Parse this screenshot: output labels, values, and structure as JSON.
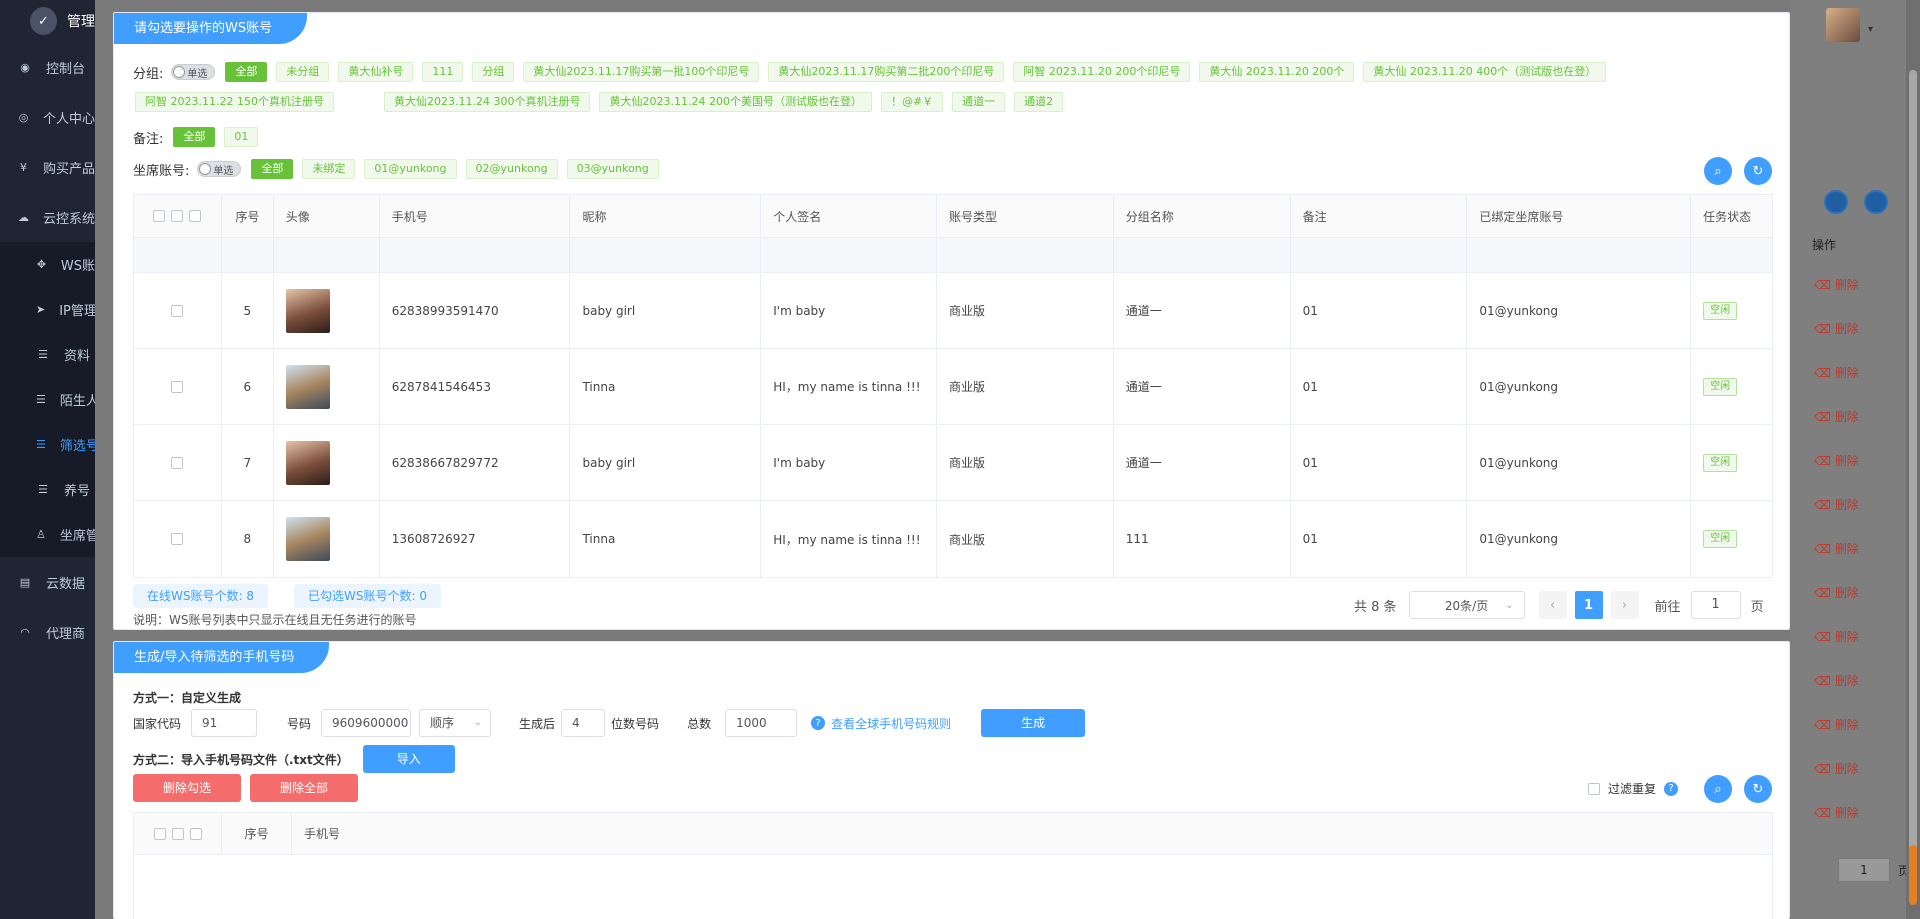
{
  "sidebar": {
    "brand": "管理",
    "items": [
      {
        "label": "控制台",
        "icon": "dashboard-icon",
        "glyph": "◉"
      },
      {
        "label": "个人中心",
        "icon": "user-icon",
        "glyph": "◎"
      },
      {
        "label": "购买产品",
        "icon": "yen-icon",
        "glyph": "¥"
      },
      {
        "label": "云控系统",
        "icon": "cloud-icon",
        "glyph": "☁"
      }
    ],
    "subitems": [
      {
        "label": "WS账",
        "icon": "move-icon",
        "glyph": "✥"
      },
      {
        "label": "IP管理",
        "icon": "send-icon",
        "glyph": "➤"
      },
      {
        "label": "资料",
        "icon": "list-icon",
        "glyph": "☰"
      },
      {
        "label": "陌生人",
        "icon": "list-icon",
        "glyph": "☰"
      },
      {
        "label": "筛选号",
        "icon": "list-icon",
        "glyph": "☰"
      },
      {
        "label": "养号",
        "icon": "list-icon",
        "glyph": "☰"
      },
      {
        "label": "坐席管",
        "icon": "person-icon",
        "glyph": "♙"
      }
    ],
    "bottom": [
      {
        "label": "云数据",
        "icon": "doc-icon",
        "glyph": "▤"
      },
      {
        "label": "代理商",
        "icon": "headset-icon",
        "glyph": "◠"
      }
    ]
  },
  "background": {
    "op_label": "操作",
    "delete_label": "删除",
    "page_value": "1",
    "page_unit": "页"
  },
  "panel1": {
    "title": "请勾选要操作的WS账号",
    "group_label": "分组:",
    "single_label": "单选",
    "group_tags": [
      "全部",
      "未分组",
      "黄大仙补号",
      "111",
      "分组",
      "黄大仙2023.11.17购买第一批100个印尼号",
      "黄大仙2023.11.17购买第二批200个印尼号",
      "阿智 2023.11.20 200个印尼号",
      "黄大仙 2023.11.20 200个",
      "黄大仙 2023.11.20 400个（测试版也在登）",
      "阿智 2023.11.22 150个真机注册号",
      "黄大仙2023.11.24 300个真机注册号",
      "黄大仙2023.11.24 200个美国号（测试版也在登）",
      "！@#￥",
      "通道一",
      "通道2"
    ],
    "remark_label": "备注:",
    "remark_tags": [
      "全部",
      "01"
    ],
    "seat_label": "坐席账号:",
    "seat_tags": [
      "全部",
      "未绑定",
      "01@yunkong",
      "02@yunkong",
      "03@yunkong"
    ],
    "headers": [
      "序号",
      "头像",
      "手机号",
      "昵称",
      "个人签名",
      "账号类型",
      "分组名称",
      "备注",
      "已绑定坐席账号",
      "任务状态"
    ],
    "rows": [
      {
        "idx": "5",
        "avatar": "av1",
        "phone": "62838993591470",
        "nick": "baby girl",
        "sign": "I'm baby",
        "type": "商业版",
        "group": "通道一",
        "remark": "01",
        "seat": "01@yunkong",
        "status": "空闲"
      },
      {
        "idx": "6",
        "avatar": "av2",
        "phone": "6287841546453",
        "nick": "Tinna",
        "sign": "HI，my name is tinna !!!",
        "type": "商业版",
        "group": "通道一",
        "remark": "01",
        "seat": "01@yunkong",
        "status": "空闲"
      },
      {
        "idx": "7",
        "avatar": "av1",
        "phone": "62838667829772",
        "nick": "baby girl",
        "sign": "I'm baby",
        "type": "商业版",
        "group": "通道一",
        "remark": "01",
        "seat": "01@yunkong",
        "status": "空闲"
      },
      {
        "idx": "8",
        "avatar": "av2",
        "phone": "13608726927",
        "nick": "Tinna",
        "sign": "HI，my name is tinna !!!",
        "type": "商业版",
        "group": "111",
        "remark": "01",
        "seat": "01@yunkong",
        "status": "空闲"
      }
    ],
    "online_count": "在线WS账号个数:  8",
    "selected_count": "已勾选WS账号个数:  0",
    "note": "说明：WS账号列表中只显示在线且无任务进行的账号",
    "total": "共 8 条",
    "page_size": "20条/页",
    "current_page": "1",
    "goto_label": "前往",
    "goto_value": "1",
    "page_unit": "页"
  },
  "panel2": {
    "title": "生成/导入待筛选的手机号码",
    "method1": "方式一：自定义生成",
    "country_label": "国家代码",
    "country_value": "91",
    "number_label": "号码",
    "number_value": "9609600000",
    "order_value": "顺序",
    "after_label": "生成后",
    "digits_value": "4",
    "digits_suffix": "位数号码",
    "total_label": "总数",
    "total_value": "1000",
    "rules_link": "查看全球手机号码规则",
    "generate_btn": "生成",
    "method2": "方式二：导入手机号码文件（.txt文件）",
    "import_btn": "导入",
    "delete_selected_btn": "删除勾选",
    "delete_all_btn": "删除全部",
    "filter_dup": "过滤重复",
    "headers": [
      "序号",
      "手机号"
    ]
  }
}
